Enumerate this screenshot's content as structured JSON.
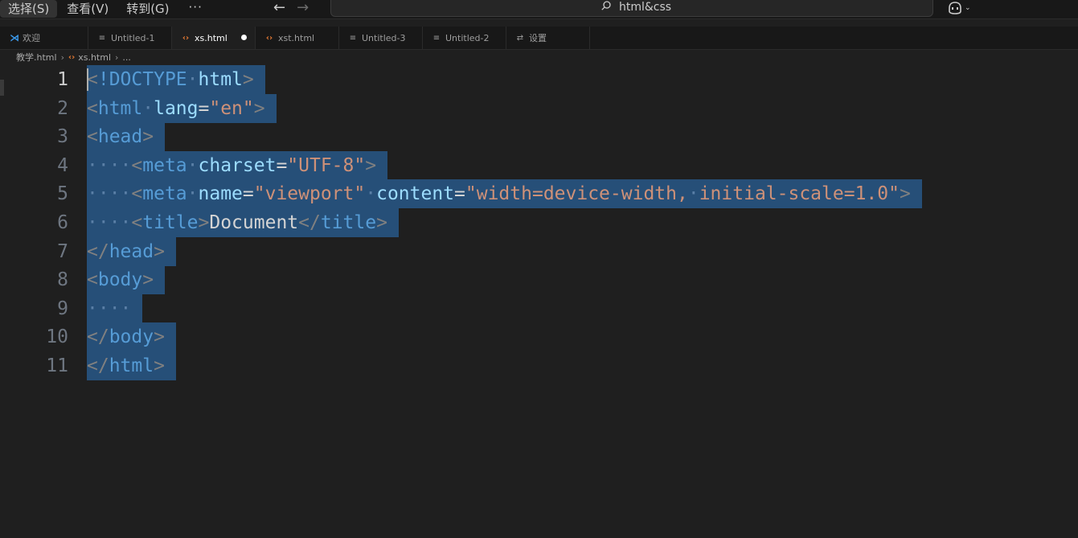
{
  "menu": {
    "items": [
      {
        "label": "选择(S)",
        "active": true
      },
      {
        "label": "查看(V)",
        "active": false
      },
      {
        "label": "转到(G)",
        "active": false
      }
    ],
    "more": "···"
  },
  "command_center": {
    "text": "html&css"
  },
  "tabs": [
    {
      "label": "欢迎",
      "icon": "vscode-logo-icon",
      "active": false
    },
    {
      "label": "Untitled-1",
      "icon": "text-file-icon",
      "active": false
    },
    {
      "label": "xs.html",
      "icon": "html-file-icon",
      "active": true,
      "modified": true
    },
    {
      "label": "xst.html",
      "icon": "html-file-icon",
      "active": false
    },
    {
      "label": "Untitled-3",
      "icon": "text-file-icon",
      "active": false
    },
    {
      "label": "Untitled-2",
      "icon": "text-file-icon",
      "active": false
    },
    {
      "label": "设置",
      "icon": "settings-icon",
      "active": false
    }
  ],
  "breadcrumb": {
    "folder": "教学.html",
    "file": "xs.html",
    "more": "..."
  },
  "editor": {
    "current_line": 1,
    "lines": [
      {
        "number": "1",
        "tokens": [
          [
            "p",
            "<"
          ],
          [
            "t",
            "!DOCTYPE"
          ],
          [
            "w",
            "·"
          ],
          [
            "a",
            "html"
          ],
          [
            "p",
            ">"
          ]
        ]
      },
      {
        "number": "2",
        "tokens": [
          [
            "p",
            "<"
          ],
          [
            "t",
            "html"
          ],
          [
            "w",
            "·"
          ],
          [
            "a",
            "lang"
          ],
          [
            "x",
            "="
          ],
          [
            "s",
            "\"en\""
          ],
          [
            "p",
            ">"
          ]
        ]
      },
      {
        "number": "3",
        "tokens": [
          [
            "p",
            "<"
          ],
          [
            "t",
            "head"
          ],
          [
            "p",
            ">"
          ]
        ]
      },
      {
        "number": "4",
        "tokens": [
          [
            "w",
            "····"
          ],
          [
            "p",
            "<"
          ],
          [
            "t",
            "meta"
          ],
          [
            "w",
            "·"
          ],
          [
            "a",
            "charset"
          ],
          [
            "x",
            "="
          ],
          [
            "s",
            "\"UTF-8\""
          ],
          [
            "p",
            ">"
          ]
        ]
      },
      {
        "number": "5",
        "tokens": [
          [
            "w",
            "····"
          ],
          [
            "p",
            "<"
          ],
          [
            "t",
            "meta"
          ],
          [
            "w",
            "·"
          ],
          [
            "a",
            "name"
          ],
          [
            "x",
            "="
          ],
          [
            "s",
            "\"viewport\""
          ],
          [
            "w",
            "·"
          ],
          [
            "a",
            "content"
          ],
          [
            "x",
            "="
          ],
          [
            "s",
            "\"width=device-width,"
          ],
          [
            "w",
            "·"
          ],
          [
            "s",
            "initial-scale=1.0\""
          ],
          [
            "p",
            ">"
          ]
        ]
      },
      {
        "number": "6",
        "tokens": [
          [
            "w",
            "····"
          ],
          [
            "p",
            "<"
          ],
          [
            "t",
            "title"
          ],
          [
            "p",
            ">"
          ],
          [
            "x",
            "Document"
          ],
          [
            "p",
            "</"
          ],
          [
            "t",
            "title"
          ],
          [
            "p",
            ">"
          ]
        ]
      },
      {
        "number": "7",
        "tokens": [
          [
            "p",
            "</"
          ],
          [
            "t",
            "head"
          ],
          [
            "p",
            ">"
          ]
        ]
      },
      {
        "number": "8",
        "tokens": [
          [
            "p",
            "<"
          ],
          [
            "t",
            "body"
          ],
          [
            "p",
            ">"
          ]
        ]
      },
      {
        "number": "9",
        "tokens": [
          [
            "w",
            "····"
          ]
        ]
      },
      {
        "number": "10",
        "tokens": [
          [
            "p",
            "</"
          ],
          [
            "t",
            "body"
          ],
          [
            "p",
            ">"
          ]
        ]
      },
      {
        "number": "11",
        "tokens": [
          [
            "p",
            "</"
          ],
          [
            "t",
            "html"
          ],
          [
            "p",
            ">"
          ]
        ]
      }
    ]
  },
  "colors": {
    "background": "#1f1f1f",
    "selection": "#264f78",
    "tag": "#569cd6",
    "attribute": "#9cdcfe",
    "string": "#ce9178",
    "punctuation": "#808080"
  }
}
